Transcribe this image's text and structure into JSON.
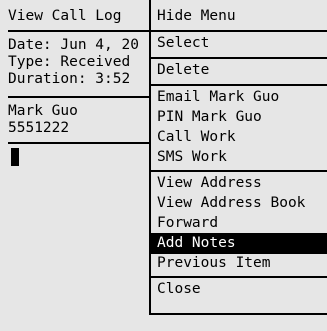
{
  "call_log": {
    "title": "View Call Log",
    "date": "Date: Jun 4, 20",
    "type": "Type: Received",
    "duration": "Duration: 3:52",
    "contact_name": "Mark Guo",
    "phone_number": "5551222"
  },
  "menu": {
    "items": [
      {
        "label": "Hide Menu"
      },
      {
        "label": "Select"
      },
      {
        "label": "Delete"
      },
      {
        "label": "Email Mark Guo"
      },
      {
        "label": "PIN Mark Guo"
      },
      {
        "label": "Call Work"
      },
      {
        "label": "SMS Work"
      },
      {
        "label": "View Address"
      },
      {
        "label": "View Address Book"
      },
      {
        "label": "Forward"
      },
      {
        "label": "Add Notes"
      },
      {
        "label": "Previous Item"
      },
      {
        "label": "Close"
      }
    ],
    "selected": "Add Notes"
  }
}
